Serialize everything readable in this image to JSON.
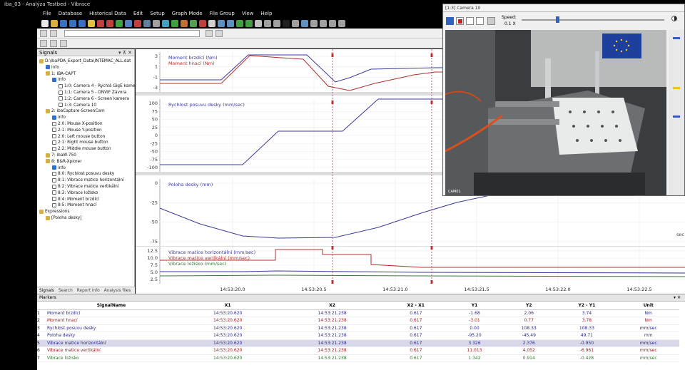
{
  "window": {
    "title": "iba_03 - Analýza Testbed - Vibrace"
  },
  "menu": [
    "File",
    "Database",
    "Historical Data",
    "Edit",
    "Setup",
    "Graph Mode",
    "File Group",
    "View",
    "Help"
  ],
  "signals_panel": {
    "title": "Signals",
    "tree": [
      {
        "label": "D:\\ibaPDA_Export_Data\\INTEMAC_ALL.dat",
        "indent": 0
      },
      {
        "label": "info",
        "indent": 1
      },
      {
        "label": "1: IBA-CAPT",
        "indent": 1
      },
      {
        "label": "info",
        "indent": 2
      },
      {
        "label": "1:0: Camera 4 - Rychlá GigE kamera",
        "indent": 3
      },
      {
        "label": "1:1: Camera 5 - ONVIF Závora",
        "indent": 3
      },
      {
        "label": "1:2: Camera 6 - Screen kamera",
        "indent": 3
      },
      {
        "label": "1:3: Camera 10",
        "indent": 3
      },
      {
        "label": "2: ibaCapture-ScreenCam",
        "indent": 1
      },
      {
        "label": "info",
        "indent": 2
      },
      {
        "label": "2:0: Mouse X-position",
        "indent": 2
      },
      {
        "label": "2:1: Mouse Y-position",
        "indent": 2
      },
      {
        "label": "2:0: Left mouse button",
        "indent": 2
      },
      {
        "label": "2:1: Right mouse button",
        "indent": 2
      },
      {
        "label": "2:2: Middle mouse button",
        "indent": 2
      },
      {
        "label": "7: ibaW-750",
        "indent": 1
      },
      {
        "label": "8: B&R-Xplorer",
        "indent": 1
      },
      {
        "label": "info",
        "indent": 2
      },
      {
        "label": "8:0: Rychlost posuvu desky",
        "indent": 2
      },
      {
        "label": "8:1: Vibrace matice horizontální",
        "indent": 2
      },
      {
        "label": "8:2: Vibrace matice vertikální",
        "indent": 2
      },
      {
        "label": "8:3: Vibrace ložisko",
        "indent": 2
      },
      {
        "label": "8:4: Moment brzdící",
        "indent": 2
      },
      {
        "label": "8:5: Moment hnací",
        "indent": 2
      },
      {
        "label": "Expressions",
        "indent": 0
      },
      {
        "label": "[Poloha desky]",
        "indent": 1
      }
    ],
    "bottom_tabs": [
      "Signals",
      "Search",
      "Report info",
      "Analysis files"
    ]
  },
  "graph": {
    "time_ticks": [
      "14:53:20.0",
      "14:53:20.5",
      "14:53:21.0",
      "14:53:21.5",
      "14:53:22.0",
      "14:53:22.5"
    ],
    "time_unit": "sec",
    "panels": [
      {
        "legend": [
          {
            "name": "Moment brzdící (Nm)",
            "color": "#3a3a9a"
          },
          {
            "name": "Moment hnací (Nm)",
            "color": "#b03030"
          }
        ],
        "yticks": [
          "3",
          "1",
          "-1",
          "-3"
        ]
      },
      {
        "legend": [
          {
            "name": "Rychlost posuvu desky (mm/sec)",
            "color": "#3a3a9a"
          }
        ],
        "yticks": [
          "100",
          "75",
          "50",
          "25",
          "0",
          "-25",
          "-50",
          "-75",
          "-100"
        ]
      },
      {
        "legend": [
          {
            "name": "Poloha desky (mm)",
            "color": "#3a3a9a"
          }
        ],
        "yticks": [
          "0",
          "-25",
          "-50",
          "-75"
        ]
      },
      {
        "legend": [
          {
            "name": "Vibrace matice horizontální (mm/sec)",
            "color": "#3a3a9a"
          },
          {
            "name": "Vibrace matice vertikální (mm/sec)",
            "color": "#b03030"
          },
          {
            "name": "Vibrace ložisko (mm/sec)",
            "color": "#3a7a3a"
          }
        ],
        "yticks": [
          "12.5",
          "10.0",
          "7.5",
          "5.0",
          "2.5"
        ]
      }
    ]
  },
  "markers": {
    "title": "Markers",
    "columns": [
      "",
      "SignalName",
      "X1",
      "X2",
      "X2 - X1",
      "Y1",
      "Y2",
      "Y2 - Y1",
      "Unit"
    ],
    "rows": [
      {
        "n": "1",
        "name": "Moment brzdící",
        "x1": "14:53:20.620",
        "x2": "14:53:21.238",
        "dx": "0.617",
        "y1": "-1.68",
        "y2": "2.06",
        "dy": "3.74",
        "unit": "Nm",
        "color": "#2a2a8a"
      },
      {
        "n": "2",
        "name": "Moment hnací",
        "x1": "14:53:20.620",
        "x2": "14:53:21.238",
        "dx": "0.617",
        "y1": "-3.01",
        "y2": "0.77",
        "dy": "3.78",
        "unit": "Nm",
        "color": "#a02020"
      },
      {
        "n": "3",
        "name": "Rychlost posuvu desky",
        "x1": "14:53:20.620",
        "x2": "14:53:21.238",
        "dx": "0.617",
        "y1": "0.00",
        "y2": "108.33",
        "dy": "108.33",
        "unit": "mm/sec",
        "color": "#2a2a8a"
      },
      {
        "n": "4",
        "name": "Poloha desky",
        "x1": "14:53:20.620",
        "x2": "14:53:21.238",
        "dx": "0.617",
        "y1": "-95.20",
        "y2": "-45.49",
        "dy": "49.71",
        "unit": "mm",
        "color": "#2a2a8a"
      },
      {
        "n": "5",
        "name": "Vibrace matice horizontální",
        "x1": "14:53:20.620",
        "x2": "14:53:21.238",
        "dx": "0.617",
        "y1": "3.326",
        "y2": "2.376",
        "dy": "-0.950",
        "unit": "mm/sec",
        "color": "#2a2a8a"
      },
      {
        "n": "6",
        "name": "Vibrace matice vertikální",
        "x1": "14:53:20.620",
        "x2": "14:53:21.238",
        "dx": "0.617",
        "y1": "11.013",
        "y2": "4.052",
        "dy": "-6.961",
        "unit": "mm/sec",
        "color": "#a02020"
      },
      {
        "n": "7",
        "name": "Vibrace ložisko",
        "x1": "14:53:20.620",
        "x2": "14:53:21.238",
        "dx": "0.617",
        "y1": "1.342",
        "y2": "0.914",
        "dy": "-0.428",
        "unit": "mm/sec",
        "color": "#2a7a2a"
      }
    ]
  },
  "camera": {
    "title": "[1:3] Camera 10",
    "speed_label": "Speed:",
    "speed_value": "0.1 X",
    "overlay_label": "CAM01"
  }
}
